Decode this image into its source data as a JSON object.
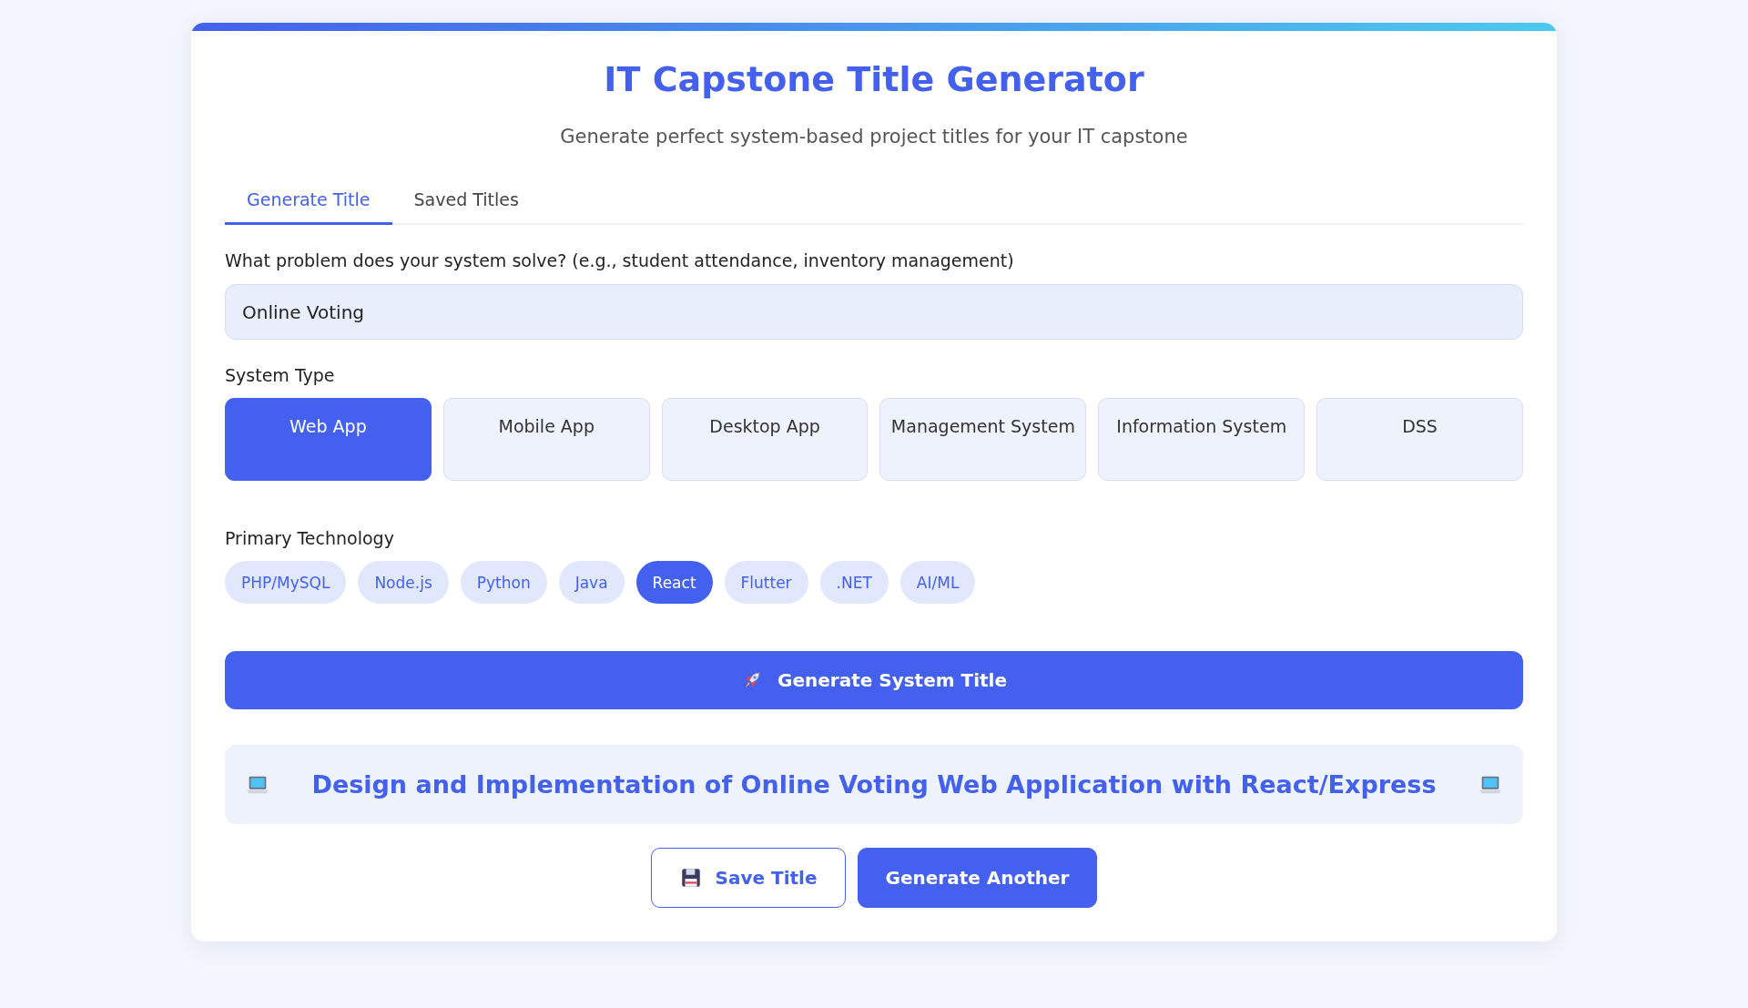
{
  "title": "IT Capstone Title Generator",
  "subtitle": "Generate perfect system-based project titles for your IT capstone",
  "tabs": [
    {
      "label": "Generate Title",
      "selected": true
    },
    {
      "label": "Saved Titles",
      "selected": false
    }
  ],
  "problem_field": {
    "label": "What problem does your system solve? (e.g., student attendance, inventory management)",
    "value": "Online Voting"
  },
  "system_type": {
    "label": "System Type",
    "options": [
      {
        "label": "Web App",
        "selected": true
      },
      {
        "label": "Mobile App",
        "selected": false
      },
      {
        "label": "Desktop App",
        "selected": false
      },
      {
        "label": "Management System",
        "selected": false
      },
      {
        "label": "Information System",
        "selected": false
      },
      {
        "label": "DSS",
        "selected": false
      }
    ]
  },
  "primary_technology": {
    "label": "Primary Technology",
    "options": [
      {
        "label": "PHP/MySQL",
        "selected": false
      },
      {
        "label": "Node.js",
        "selected": false
      },
      {
        "label": "Python",
        "selected": false
      },
      {
        "label": "Java",
        "selected": false
      },
      {
        "label": "React",
        "selected": true
      },
      {
        "label": "Flutter",
        "selected": false
      },
      {
        "label": ".NET",
        "selected": false
      },
      {
        "label": "AI/ML",
        "selected": false
      }
    ]
  },
  "generate_button": "Generate System Title",
  "result_title": "Design and Implementation of Online Voting Web Application with React/Express",
  "actions": [
    {
      "kind": "outline",
      "label": "Save Title"
    },
    {
      "kind": "primary",
      "label": "Generate Another"
    }
  ]
}
